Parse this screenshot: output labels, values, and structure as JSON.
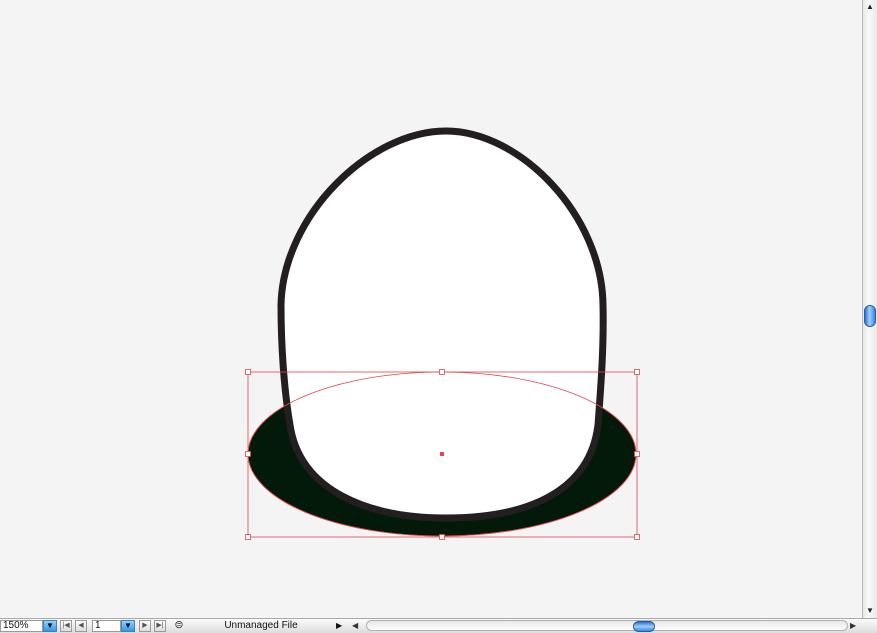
{
  "window": {
    "title": ""
  },
  "artwork": {
    "egg": {
      "fill": "#ffffff",
      "stroke": "#231f20"
    },
    "shadow_ellipse": {
      "fill": "#031a0b",
      "selected": true
    },
    "selection": {
      "color": "#e0484c",
      "handles": 8
    }
  },
  "statusbar": {
    "zoom_value": "150%",
    "page_value": "1",
    "status_text": "Unmanaged File",
    "icons": {
      "zoom_dropdown": "triangle-down",
      "first_page": "first-page",
      "prev_page": "prev-page",
      "page_dropdown": "triangle-down",
      "next_page": "next-page",
      "last_page": "last-page",
      "version_cue": "version-cue-icon",
      "status_menu": "triangle-right"
    }
  },
  "scrollbars": {
    "vertical": {
      "position": 0.5
    },
    "horizontal": {
      "position": 0.55
    }
  }
}
